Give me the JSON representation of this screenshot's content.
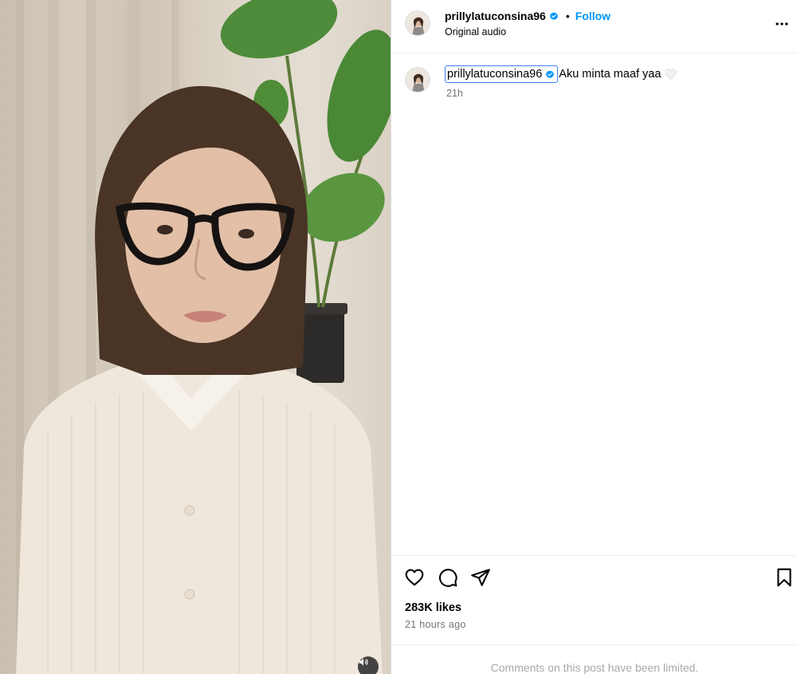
{
  "media": {
    "type": "video",
    "mute_icon": "speaker-icon"
  },
  "header": {
    "username": "prillylatuconsina96",
    "verified_icon": "verified-badge-icon",
    "separator": "•",
    "follow_label": "Follow",
    "audio_label": "Original audio",
    "more_icon": "more-options-icon"
  },
  "caption": {
    "username": "prillylatuconsina96",
    "text": "Aku minta maaf yaa",
    "emoji_icon": "white-heart-icon",
    "time": "21h"
  },
  "actions": {
    "like_icon": "heart-outline-icon",
    "comment_icon": "comment-icon",
    "share_icon": "send-icon",
    "save_icon": "bookmark-icon",
    "likes": "283K likes",
    "time_ago": "21 hours ago"
  },
  "footer": {
    "comments_notice": "Comments on this post have been limited."
  },
  "colors": {
    "follow": "#0095f6",
    "verified": "#0095f6",
    "muted_text": "#737373",
    "focus_outline": "#3b82f6"
  }
}
